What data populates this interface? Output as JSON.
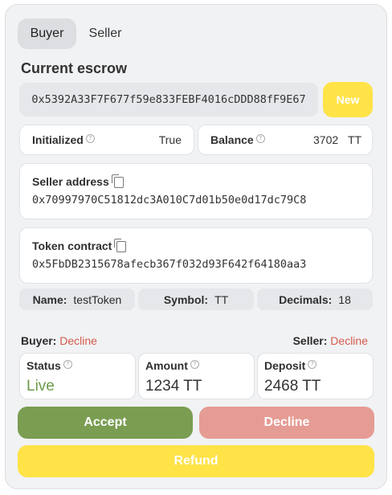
{
  "tabs": {
    "buyer": "Buyer",
    "seller": "Seller"
  },
  "escrow": {
    "title": "Current escrow",
    "address": "0x5392A33F7F677f59e833FEBF4016cDDD88fF9E67",
    "new_label": "New"
  },
  "initialized": {
    "label": "Initialized",
    "value": "True"
  },
  "balance": {
    "label": "Balance",
    "amount": "3702",
    "unit": "TT"
  },
  "seller_address": {
    "label": "Seller address",
    "value": "0x70997970C51812dc3A010C7d01b50e0d17dc79C8"
  },
  "token_contract": {
    "label": "Token contract",
    "value": "0x5FbDB2315678afecb367f032d93F642f64180aa3"
  },
  "token": {
    "name_label": "Name:",
    "name": "testToken",
    "symbol_label": "Symbol:",
    "symbol": "TT",
    "decimals_label": "Decimals:",
    "decimals": "18"
  },
  "votes": {
    "buyer_label": "Buyer:",
    "buyer_vote": "Decline",
    "seller_label": "Seller:",
    "seller_vote": "Decline"
  },
  "status": {
    "label": "Status",
    "value": "Live"
  },
  "amount": {
    "label": "Amount",
    "value": "1234 TT"
  },
  "deposit": {
    "label": "Deposit",
    "value": "2468 TT"
  },
  "actions": {
    "accept": "Accept",
    "decline": "Decline",
    "refund": "Refund"
  },
  "colors": {
    "accent_yellow": "#ffe347",
    "accept_green": "#7a9d52",
    "decline_pink": "#e59c94",
    "decline_text": "#d45a4a",
    "live_green": "#6c9a4a"
  },
  "icons": {
    "info": "info-circle-icon",
    "copy": "copy-icon"
  }
}
